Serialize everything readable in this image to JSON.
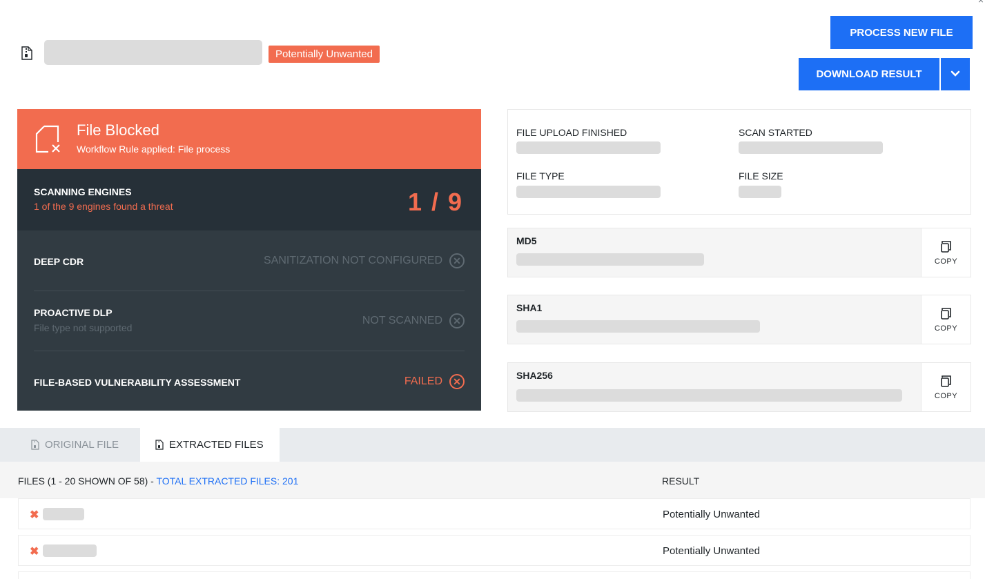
{
  "header": {
    "close_glyph": "×",
    "badge": "Potentially Unwanted",
    "process_button": "PROCESS NEW FILE",
    "download_button": "DOWNLOAD RESULT"
  },
  "status": {
    "title": "File Blocked",
    "subtitle": "Workflow Rule applied: File process"
  },
  "engines": {
    "title": "SCANNING ENGINES",
    "subtitle": "1 of the 9 engines found a threat",
    "count": "1 / 9"
  },
  "checks": [
    {
      "title": "DEEP CDR",
      "subtitle": "",
      "status": "SANITIZATION NOT CONFIGURED",
      "state": "muted"
    },
    {
      "title": "PROACTIVE DLP",
      "subtitle": "File type not supported",
      "status": "NOT SCANNED",
      "state": "muted"
    },
    {
      "title": "FILE-BASED VULNERABILITY ASSESSMENT",
      "subtitle": "",
      "status": "FAILED",
      "state": "fail"
    }
  ],
  "info": {
    "upload_label": "FILE UPLOAD FINISHED",
    "scan_label": "SCAN STARTED",
    "type_label": "FILE TYPE",
    "size_label": "FILE SIZE"
  },
  "hashes": [
    {
      "label": "MD5",
      "copy": "COPY"
    },
    {
      "label": "SHA1",
      "copy": "COPY"
    },
    {
      "label": "SHA256",
      "copy": "COPY"
    }
  ],
  "tabs": [
    {
      "label": "ORIGINAL FILE",
      "active": false
    },
    {
      "label": "EXTRACTED FILES",
      "active": true
    }
  ],
  "table": {
    "files_header": "FILES (1 - 20 SHOWN OF 58) - ",
    "total_link": "TOTAL EXTRACTED FILES: 201",
    "result_header": "RESULT",
    "rows": [
      {
        "result": "Potentially Unwanted"
      },
      {
        "result": "Potentially Unwanted"
      }
    ]
  },
  "colors": {
    "accent_orange": "#f26c4f",
    "primary_blue": "#1d6ff5",
    "dark_panel": "#263038",
    "dark_rows": "#313b42"
  },
  "icons": [
    "file-archive-icon",
    "file-blocked-icon",
    "circle-x-icon",
    "copy-icon",
    "chevron-down-icon",
    "x-mark-icon"
  ]
}
